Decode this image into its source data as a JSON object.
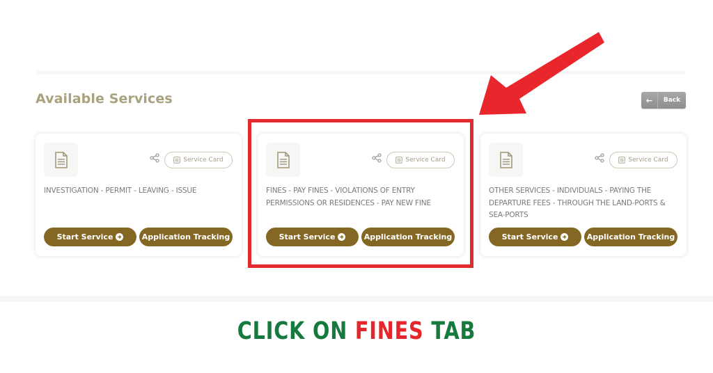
{
  "page": {
    "section_title": "Available Services",
    "back_button": {
      "label": "Back",
      "icon": "arrow-left-icon"
    }
  },
  "services": [
    {
      "description": "INVESTIGATION - PERMIT - LEAVING - ISSUE",
      "service_card_label": "Service Card",
      "start_label": "Start Service",
      "tracking_label": "Application Tracking",
      "highlighted": false
    },
    {
      "description": "FINES - PAY FINES - VIOLATIONS OF ENTRY PERMISSIONS OR RESIDENCES - PAY NEW FINE",
      "service_card_label": "Service Card",
      "start_label": "Start Service",
      "tracking_label": "Application Tracking",
      "highlighted": true
    },
    {
      "description": "OTHER SERVICES - INDIVIDUALS - PAYING THE DEPARTURE FEES - THROUGH THE LAND-PORTS & SEA-PORTS",
      "service_card_label": "Service Card",
      "start_label": "Start Service",
      "tracking_label": "Application Tracking",
      "highlighted": false
    }
  ],
  "annotation": {
    "caption_part1": "CLICK ON ",
    "caption_part2": "FINES",
    "caption_part3": " TAB",
    "colors": {
      "green": "#16793d",
      "red": "#e5262b",
      "highlight": "#e32a2f"
    }
  },
  "theme": {
    "accent": "#856724",
    "title_color": "#a8a27e"
  }
}
